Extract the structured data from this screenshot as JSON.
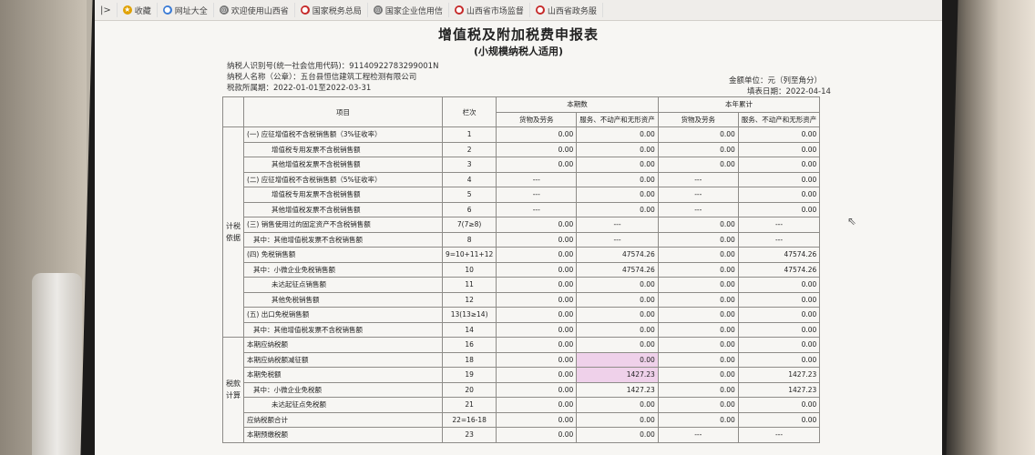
{
  "bookmarks": [
    {
      "icon": "star-icon",
      "label": "收藏",
      "color": "#e0a100"
    },
    {
      "icon": "grid-icon",
      "label": "网址大全",
      "color": "#3a7bd5"
    },
    {
      "icon": "globe-icon",
      "label": "欢迎使用山西省",
      "color": "#777777"
    },
    {
      "icon": "emblem-icon",
      "label": "国家税务总局",
      "color": "#c62828"
    },
    {
      "icon": "globe-icon",
      "label": "国家企业信用信",
      "color": "#777777"
    },
    {
      "icon": "emblem-icon",
      "label": "山西省市场监督",
      "color": "#c62828"
    },
    {
      "icon": "flag-icon",
      "label": "山西省政务服",
      "color": "#c62828"
    }
  ],
  "form": {
    "title": "增值税及附加税费申报表",
    "subtitle": "(小规模纳税人适用)",
    "taxpayer_id": "纳税人识别号(统一社会信用代码)：91140922783299001N",
    "taxpayer_name": "纳税人名称（公章）：五台县恒信建筑工程检测有限公司",
    "period": "税款所属期：2022-01-01至2022-03-31",
    "unit": "金额单位：元（列至角分）",
    "fill_date": "填表日期：2022-04-14"
  },
  "headers": {
    "item": "项目",
    "column": "栏次",
    "current": "本期数",
    "ytd": "本年累计",
    "goods": "货物及劳务",
    "services": "服务、不动产和无形资产"
  },
  "sections": {
    "basis": "计税依据",
    "calc": "税款计算"
  },
  "rows": [
    {
      "item": "(一) 应征增值税不含税销售额（3%征收率）",
      "col": "1",
      "v": [
        "0.00",
        "0.00",
        "0.00",
        "0.00"
      ]
    },
    {
      "item": "增值税专用发票不含税销售额",
      "col": "2",
      "v": [
        "0.00",
        "0.00",
        "0.00",
        "0.00"
      ]
    },
    {
      "item": "其他增值税发票不含税销售额",
      "col": "3",
      "v": [
        "0.00",
        "0.00",
        "0.00",
        "0.00"
      ]
    },
    {
      "item": "(二) 应征增值税不含税销售额（5%征收率）",
      "col": "4",
      "v": [
        "---",
        "0.00",
        "---",
        "0.00"
      ]
    },
    {
      "item": "增值税专用发票不含税销售额",
      "col": "5",
      "v": [
        "---",
        "0.00",
        "---",
        "0.00"
      ]
    },
    {
      "item": "其他增值税发票不含税销售额",
      "col": "6",
      "v": [
        "---",
        "0.00",
        "---",
        "0.00"
      ]
    },
    {
      "item": "(三) 销售使用过的固定资产不含税销售额",
      "col": "7(7≥8)",
      "v": [
        "0.00",
        "---",
        "0.00",
        "---"
      ]
    },
    {
      "item": "其中：其他增值税发票不含税销售额",
      "col": "8",
      "v": [
        "0.00",
        "---",
        "0.00",
        "---"
      ]
    },
    {
      "item": "(四) 免税销售额",
      "col": "9=10+11+12",
      "v": [
        "0.00",
        "47574.26",
        "0.00",
        "47574.26"
      ]
    },
    {
      "item": "其中：小微企业免税销售额",
      "col": "10",
      "v": [
        "0.00",
        "47574.26",
        "0.00",
        "47574.26"
      ]
    },
    {
      "item": "未达起征点销售额",
      "col": "11",
      "v": [
        "0.00",
        "0.00",
        "0.00",
        "0.00"
      ]
    },
    {
      "item": "其他免税销售额",
      "col": "12",
      "v": [
        "0.00",
        "0.00",
        "0.00",
        "0.00"
      ]
    },
    {
      "item": "(五) 出口免税销售额",
      "col": "13(13≥14)",
      "v": [
        "0.00",
        "0.00",
        "0.00",
        "0.00"
      ]
    },
    {
      "item": "其中：其他增值税发票不含税销售额",
      "col": "14",
      "v": [
        "0.00",
        "0.00",
        "0.00",
        "0.00"
      ]
    },
    {
      "item": "本期应纳税额",
      "col": "16",
      "v": [
        "0.00",
        "0.00",
        "0.00",
        "0.00"
      ]
    },
    {
      "item": "本期应纳税额减征额",
      "col": "18",
      "v": [
        "0.00",
        "0.00",
        "0.00",
        "0.00"
      ]
    },
    {
      "item": "本期免税额",
      "col": "19",
      "v": [
        "0.00",
        "1427.23",
        "0.00",
        "1427.23"
      ]
    },
    {
      "item": "其中：小微企业免税额",
      "col": "20",
      "v": [
        "0.00",
        "1427.23",
        "0.00",
        "1427.23"
      ]
    },
    {
      "item": "未达起征点免税额",
      "col": "21",
      "v": [
        "0.00",
        "0.00",
        "0.00",
        "0.00"
      ]
    },
    {
      "item": "应纳税额合计",
      "col": "22=16-18",
      "v": [
        "0.00",
        "0.00",
        "0.00",
        "0.00"
      ]
    },
    {
      "item": "本期预缴税额",
      "col": "23",
      "v": [
        "0.00",
        "0.00",
        "---",
        "---"
      ]
    }
  ]
}
